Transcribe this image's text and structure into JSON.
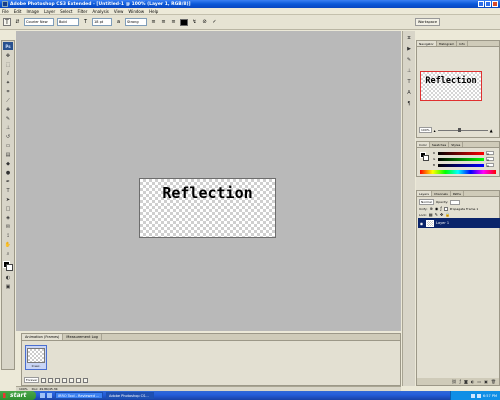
{
  "app": {
    "title": "Adobe Photoshop CS3 Extended - [Untitled-1 @ 100% (Layer 1, RGB/8)]"
  },
  "menu": [
    "File",
    "Edit",
    "Image",
    "Layer",
    "Select",
    "Filter",
    "Analysis",
    "View",
    "Window",
    "Help"
  ],
  "options_bar": {
    "font_family": "Courier New",
    "font_style": "Bold",
    "font_size": "18 pt",
    "antialias": "Strong",
    "workspace_label": "Workspace"
  },
  "canvas": {
    "text": "Reflection"
  },
  "animation": {
    "tabs": [
      "Animation (Frames)",
      "Measurement Log"
    ],
    "frame_delay": "0 sec.",
    "loop": "Forever"
  },
  "status": {
    "zoom": "100%",
    "doc": "Doc: 49.8K/45.3K"
  },
  "navigator": {
    "tabs": [
      "Navigator",
      "Histogram",
      "Info"
    ],
    "preview_text": "Reflection",
    "zoom": "100%"
  },
  "color_panel": {
    "tabs": [
      "Color",
      "Swatches",
      "Styles"
    ],
    "rows": [
      {
        "label": "R",
        "value": "0"
      },
      {
        "label": "G",
        "value": "0"
      },
      {
        "label": "B",
        "value": "0"
      }
    ]
  },
  "layers": {
    "tabs": [
      "Layers",
      "Channels",
      "Paths"
    ],
    "blend_mode": "Normal",
    "opacity_label": "Opacity:",
    "unify_label": "Unify:",
    "propagate_label": "Propagate Frame 1",
    "lock_label": "Lock:",
    "items": [
      {
        "name": "Layer 1"
      }
    ]
  },
  "taskbar": {
    "start": "start",
    "items": [
      "IRRO Tool - Reviewed ...",
      "Adobe Photoshop CS..."
    ],
    "clock": "6:57 PM"
  }
}
